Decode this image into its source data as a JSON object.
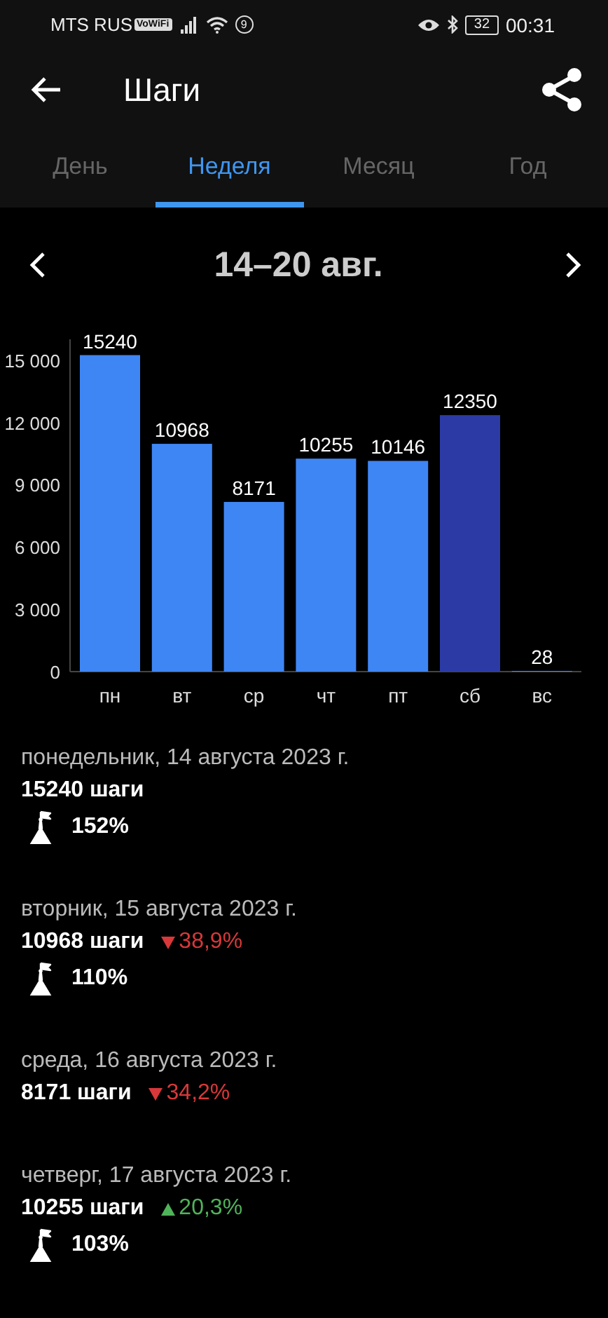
{
  "status_bar": {
    "carrier": "MTS RUS",
    "wifi_badge": "VoWiFi",
    "notification_count": "9",
    "battery": "32",
    "time": "00:31"
  },
  "header": {
    "title": "Шаги"
  },
  "tabs": [
    {
      "label": "День",
      "selected": false
    },
    {
      "label": "Неделя",
      "selected": true
    },
    {
      "label": "Месяц",
      "selected": false
    },
    {
      "label": "Год",
      "selected": false
    }
  ],
  "period": {
    "label": "14–20 авг."
  },
  "chart": {
    "chart_data": {
      "type": "bar",
      "categories": [
        "пн",
        "вт",
        "ср",
        "чт",
        "пт",
        "сб",
        "вс"
      ],
      "series": [
        {
          "color": "#3f86f5",
          "values": [
            15240,
            10968,
            8171,
            10255,
            10146,
            null,
            28
          ]
        },
        {
          "color": "#2c3aa6",
          "values": [
            null,
            null,
            null,
            null,
            null,
            12350,
            null
          ]
        }
      ],
      "stacked": true,
      "ylim": [
        0,
        16000
      ],
      "yticks": [
        {
          "value": 0,
          "label": "0"
        },
        {
          "value": 3000,
          "label": "3 000"
        },
        {
          "value": 6000,
          "label": "6 000"
        },
        {
          "value": 9000,
          "label": "9 000"
        },
        {
          "value": 12000,
          "label": "12 000"
        },
        {
          "value": 15000,
          "label": "15 000"
        }
      ],
      "data_labels": true
    }
  },
  "days": [
    {
      "date": "понедельник, 14 августа 2023 г.",
      "steps": "15240 шаги",
      "goal": "152%"
    },
    {
      "date": "вторник, 15 августа 2023 г.",
      "steps": "10968 шаги",
      "change": {
        "kind": "decrease",
        "text": "38,9%"
      },
      "goal": "110%"
    },
    {
      "date": "среда, 16 августа 2023 г.",
      "steps": "8171 шаги",
      "change": {
        "kind": "decrease",
        "text": "34,2%"
      }
    },
    {
      "date": "четверг, 17 августа 2023 г.",
      "steps": "10255 шаги",
      "change": {
        "kind": "increase",
        "text": "20,3%"
      },
      "goal": "103%"
    }
  ]
}
